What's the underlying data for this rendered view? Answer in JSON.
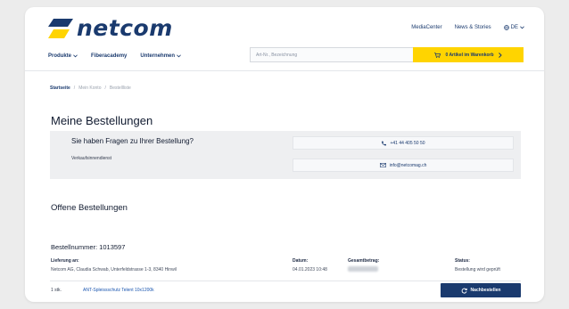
{
  "brand": {
    "name": "netcom",
    "color": "#1a3a6e",
    "accent": "#ffd400"
  },
  "top_links": {
    "media": "MediaCenter",
    "news": "News & Stories",
    "language": "DE"
  },
  "nav": {
    "products": "Produkte",
    "fiberacademy": "Fiberacademy",
    "company": "Unternehmen"
  },
  "search": {
    "placeholder": "Art-Nr., Bezeichnung"
  },
  "cart": {
    "label": "0 Artikel im Warenkorb"
  },
  "breadcrumb": {
    "home": "Startseite",
    "sep": "/",
    "account": "Mein Konto",
    "current": "Bestellliste"
  },
  "page": {
    "title": "Meine Bestellungen"
  },
  "help": {
    "title": "Sie haben Fragen zu Ihrer Bestellung?",
    "subtitle": "Verkaufsinnendienst",
    "phone": "+41 44 405 50 50",
    "email": "info@netcomag.ch"
  },
  "open_orders": {
    "title": "Offene Bestellungen"
  },
  "order": {
    "number": "Bestellnummer: 1013597",
    "delivery_label": "Lieferung an:",
    "delivery_value": "Netcom AG, Claudia Schwab, Unterfeldstrasse 1-3, 8340 Hinwil",
    "date_label": "Datum:",
    "date_value": "04.01.2023 10:48",
    "total_label": "Gesamtbetrag:",
    "status_label": "Status:",
    "status_value": "Bestellung wird geprüft",
    "qty": "1 stk.",
    "product": "ANT-Spleissschutz Telent 10x1200k",
    "reorder": "Nachbestellen"
  }
}
